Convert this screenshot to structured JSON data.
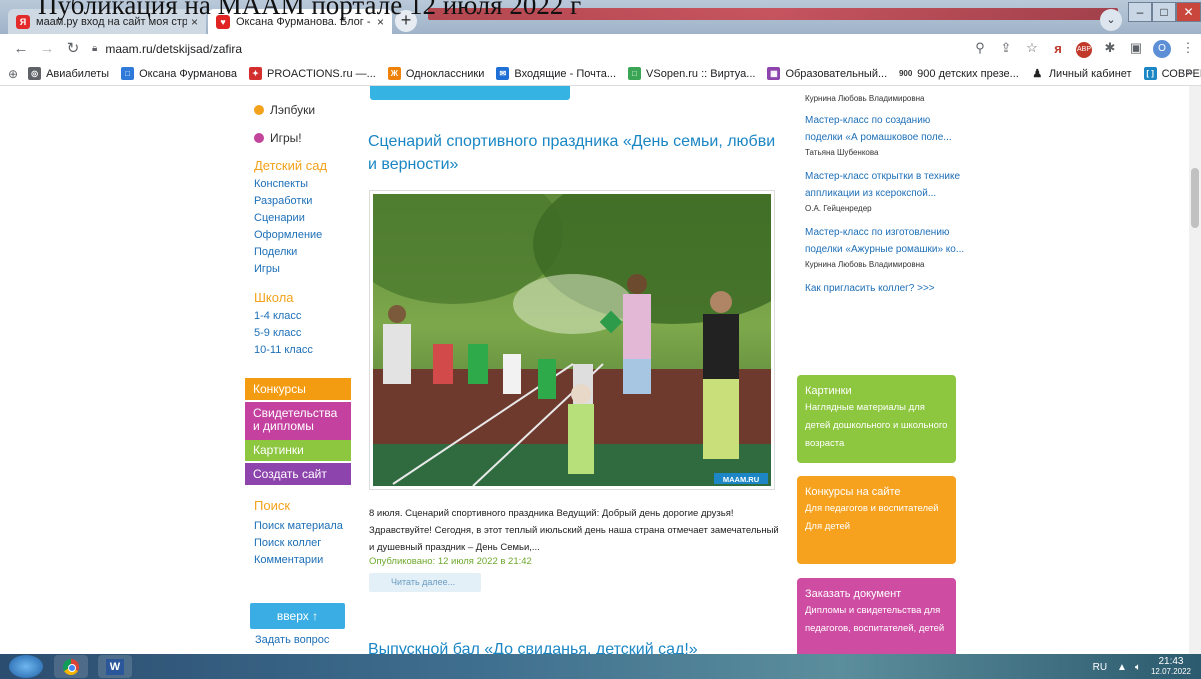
{
  "overlay_caption": "Публикация на МААМ портале 12 июля 2022 г",
  "browser": {
    "tabs": [
      {
        "title": "маам.ру вход на сайт моя стран",
        "favicon": "yandex-icon",
        "favicon_color": "#e32b2b",
        "active": false
      },
      {
        "title": "Оксана Фурманова. Блог - Стра",
        "favicon": "maam-icon",
        "favicon_color": "#e02424",
        "active": true
      }
    ],
    "close_glyph": "×",
    "new_tab_glyph": "+",
    "url": "maam.ru/detskijsad/zafira",
    "bookmarks": [
      {
        "label": "Авиабилеты",
        "icon": "globe-icon",
        "color": "#5f6368"
      },
      {
        "label": "Оксана Фурманова",
        "icon": "blog-icon",
        "color": "#2f7ad8"
      },
      {
        "label": "PROACTIONS.ru —...",
        "icon": "gift-icon",
        "color": "#d32f2f"
      },
      {
        "label": "Одноклассники",
        "icon": "ok-icon",
        "color": "#ee8208"
      },
      {
        "label": "Входящие - Почта...",
        "icon": "mail-icon",
        "color": "#1e6fd6"
      },
      {
        "label": "VSopen.ru :: Виртуа...",
        "icon": "vsopen-icon",
        "color": "#3aa655"
      },
      {
        "label": "Образовательный...",
        "icon": "edu-icon",
        "color": "#8e44ad"
      },
      {
        "label": "900 детских презе...",
        "icon": "900-icon",
        "color": "#333333"
      },
      {
        "label": "Личный кабинет",
        "icon": "person-icon",
        "color": "#222222"
      },
      {
        "label": "СОВРЕМЕННЫЙ УР...",
        "icon": "lesson-icon",
        "color": "#1a86c4"
      }
    ]
  },
  "sidebar": {
    "dot_items": [
      {
        "label": "Лэпбуки",
        "color": "#f3a21c"
      },
      {
        "label": "Игры!",
        "color": "#c2449b"
      }
    ],
    "sections": [
      {
        "title": "Детский сад",
        "links": [
          "Конспекты",
          "Разработки",
          "Сценарии",
          "Оформление",
          "Поделки",
          "Игры"
        ]
      },
      {
        "title": "Школа",
        "links": [
          "1-4 класс",
          "5-9 класс",
          "10-11 класс"
        ]
      }
    ],
    "color_buttons": [
      {
        "label": "Конкурсы",
        "color": "#f39c12"
      },
      {
        "label": "Свидетельства и дипломы",
        "color": "#c541a0"
      },
      {
        "label": "Картинки",
        "color": "#8dc63f"
      },
      {
        "label": "Создать сайт",
        "color": "#8e44ad"
      }
    ],
    "search": {
      "title": "Поиск",
      "links": [
        "Поиск материала",
        "Поиск коллег",
        "Комментарии"
      ]
    },
    "up_button": "вверх ↑",
    "ask_question": "Задать вопрос"
  },
  "main": {
    "post1_title": "Сценарий спортивного праздника «День семьи, любви и верности»",
    "photo_watermark": "MAAM.RU",
    "excerpt": "8 июля. Сценарий спортивного праздника Ведущий: Добрый день дорогие друзья! Здравствуйте! Сегодня, в этот теплый июльский день наша страна отмечает замечательный и душевный праздник – День Семьи,...",
    "published": "Опубликовано: 12 июля 2022 в 21:42",
    "read_more": "Читать далее...",
    "post2_title": "Выпускной бал «До свиданья, детский сад!»"
  },
  "right": {
    "top_author": "Курнина Любовь Владимировна",
    "items": [
      {
        "link": "Мастер-класс по созданию поделки «А ромашковое поле...",
        "author": "Татьяна Шубенкова"
      },
      {
        "link": "Мастер-класс открытки в технике аппликации из ксерокспой...",
        "author": "О.А. Гейценредер"
      },
      {
        "link": "Мастер-класс по изготовлению поделки «Ажурные ромашки» ко...",
        "author": "Курнина Любовь Владимировна"
      }
    ],
    "invite": "Как пригласить коллег? >>>",
    "boxes": [
      {
        "title": "Картинки",
        "desc": "Наглядные материалы для детей дошкольного и школьного возраста",
        "color": "#8dc63f"
      },
      {
        "title": "Конкурсы на сайте",
        "desc": "Для педагогов и воспитателей\nДля детей",
        "color": "#f6a21f"
      },
      {
        "title": "Заказать документ",
        "desc": "Дипломы и свидетельства для педагогов, воспитателей, детей",
        "color": "#cf4ca3"
      }
    ]
  },
  "taskbar": {
    "lang": "RU",
    "time": "21:43",
    "date": "12.07.2022"
  }
}
